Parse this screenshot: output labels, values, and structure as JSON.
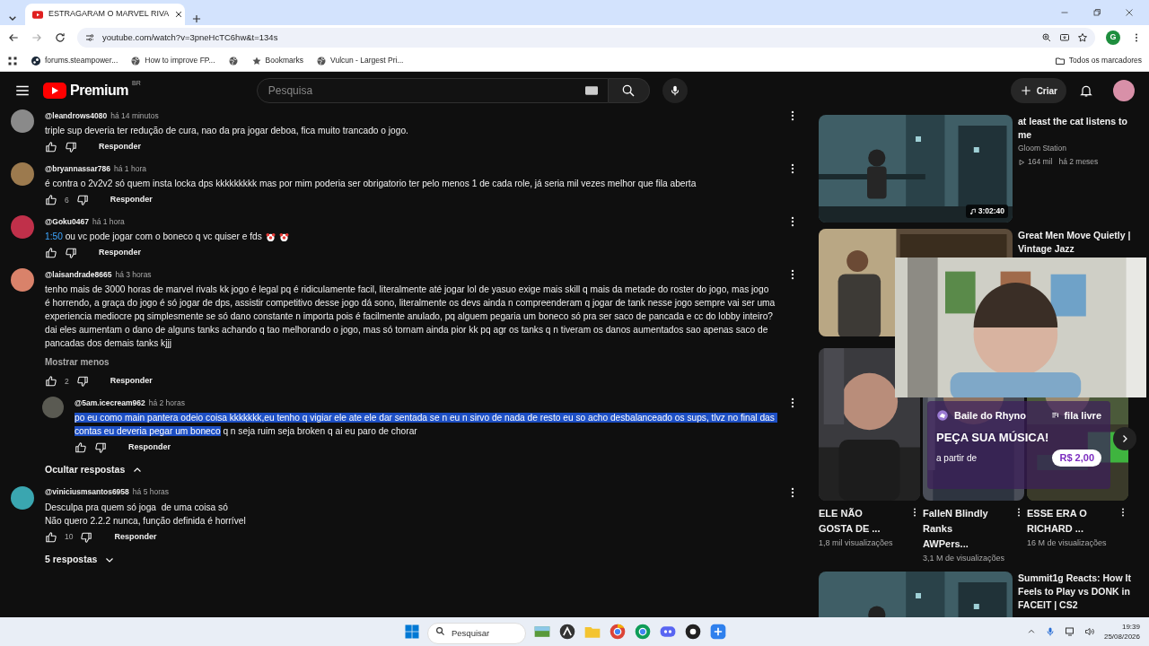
{
  "browser": {
    "tab": {
      "title": "ESTRAGARAM O MARVEL RIVA"
    },
    "url": "youtube.com/watch?v=3pneHcTC6hw&t=134s",
    "profile_initial": "G",
    "bookmarks": [
      {
        "kind": "steam",
        "label": "forums.steampower..."
      },
      {
        "kind": "globe",
        "label": "How to improve FP..."
      },
      {
        "kind": "globe"
      },
      {
        "kind": "star",
        "label": "Bookmarks"
      },
      {
        "kind": "globe",
        "label": "Vulcun - Largest Pri..."
      }
    ],
    "all_bookmarks": "Todos os marcadores"
  },
  "header": {
    "logo": "Premium",
    "region": "BR",
    "search": {
      "placeholder": "Pesquisa"
    },
    "create": "Criar"
  },
  "comments": [
    {
      "handle": "@leandrows4080",
      "time": "há 14 minutos",
      "color": "#8a8a8a",
      "text": "triple sup deveria ter redução de cura, nao da pra jogar deboa, fica muito trancado o jogo.",
      "reply_label": "Responder"
    },
    {
      "handle": "@bryannassar786",
      "time": "há 1 hora",
      "color": "#9c7a4e",
      "text": "é contra o 2v2v2 só quem insta locka dps kkkkkkkkk mas por mim poderia ser obrigatorio ter pelo menos 1 de cada role, já seria mil vezes melhor que fila aberta",
      "likes": "6",
      "reply_label": "Responder"
    },
    {
      "handle": "@Goku0467",
      "time": "há 1 hora",
      "color": "#c0304a",
      "timestamp": "1:50",
      "text": "ou vc pode jogar com o boneco q vc quiser e fds",
      "emojis": [
        {
          "kind": "clown"
        },
        {
          "kind": "clown"
        }
      ],
      "reply_label": "Responder"
    },
    {
      "handle": "@laisandrade8665",
      "time": "há 3 horas",
      "color": "#d9826a",
      "text": "tenho mais de 3000 horas de marvel rivals kk jogo é legal pq é ridiculamente facil, literalmente até jogar lol de yasuo exige mais skill q mais da metade do roster do jogo, mas jogo é horrendo, a graça do jogo é só jogar de dps, assistir competitivo desse jogo dá sono, literalmente os devs ainda n compreenderam q jogar de tank nesse jogo sempre vai ser uma experiencia mediocre pq simplesmente se só dano constante n importa pois é facilmente anulado, pq alguem pegaria um boneco só pra ser saco de pancada e cc do lobby inteiro? dai eles aumentam o dano de alguns tanks achando q tao melhorando o jogo, mas só tornam ainda pior kk pq agr os tanks q n tiveram os danos aumentados sao apenas saco de pancadas dos demais tanks kjjj",
      "more": "Mostrar menos",
      "likes": "2",
      "reply_label": "Responder",
      "replies": [
        {
          "handle": "@5am.icecream962",
          "time": "há 2 horas",
          "color": "#5a5a52",
          "selection": "po eu como main pantera odeio coisa kkkkkkk,eu tenho q vigiar ele ate ele dar sentada se n eu n sirvo de nada de resto eu so acho desbalanceado os sups, tlvz no final das contas eu deveria pegar um boneco",
          "text": " q n seja ruim seja broken q ai eu paro de chorar",
          "reply_label": "Responder"
        }
      ],
      "replies_toggle": {
        "label": "Ocultar respostas",
        "expanded": true
      }
    },
    {
      "handle": "@viniciusmsantos6958",
      "time": "há 5 horas",
      "color": "#3aa6b0",
      "text": "Desculpa pra quem só joga  de uma coisa só\nNão quero 2.2.2 nunca, função definida é horrível",
      "likes": "10",
      "reply_label": "Responder",
      "replies_toggle": {
        "label": "5 respostas",
        "expanded": false
      }
    }
  ],
  "sidebar": [
    {
      "kind": "video",
      "title": "at least the cat listens to me",
      "channel": "Gloom Station",
      "views": "164 mil",
      "age": "há 2 meses",
      "duration": "3:02:40"
    },
    {
      "kind": "video",
      "title": "Great Men Move Quietly | Vintage Jazz"
    },
    {
      "kind": "shorts",
      "items": [
        {
          "title": "ELE NÃO GOSTA DE ...",
          "views": "1,8 mil visualizações"
        },
        {
          "title": "FalleN Blindly Ranks AWPers...",
          "views": "3,1 M de visualizações"
        },
        {
          "title": "ESSE ERA O RICHARD ...",
          "views": "16 M de visualizações"
        }
      ]
    },
    {
      "kind": "video",
      "title": "Summit1g Reacts: How It Feels to Play vs DONK in FACEIT | CS2"
    }
  ],
  "overlay": {
    "song_widget": {
      "channel": "Baile do Rhyno",
      "queue": "fila livre",
      "headline": "PEÇA SUA MÚSICA!",
      "price_label": "a partir de",
      "price": "R$ 2,00"
    }
  },
  "taskbar": {
    "search": {
      "placeholder": "Pesquisar"
    },
    "time": "19:39",
    "date": "25/08/2026"
  }
}
